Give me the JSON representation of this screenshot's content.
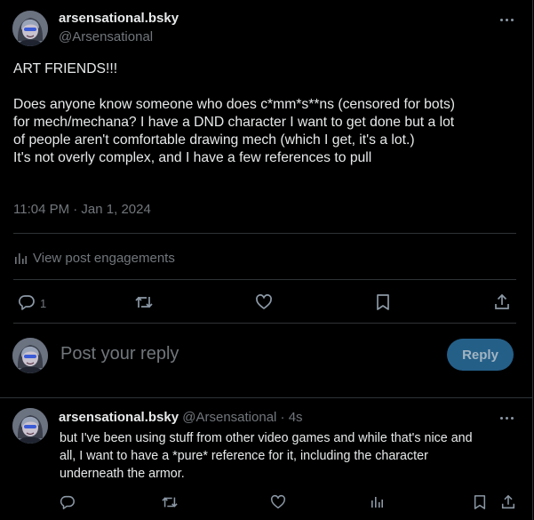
{
  "tweet": {
    "author": {
      "display_name": "arsensational.bsky",
      "handle": "@Arsensational",
      "avatar_icon": "avatar-icon"
    },
    "text_lines": [
      "ART FRIENDS!!!",
      "",
      "Does anyone know someone who does c*mm*s**ns (censored for bots)",
      "for mech/mechana? I have a DND character I want to get done but a lot",
      "of people aren't comfortable drawing mech (which I get, it's a lot.)",
      "It's not overly complex, and I have a few references to pull"
    ],
    "timestamp": "11:04 PM · Jan 1, 2024",
    "engagements_label": "View post engagements",
    "actions": {
      "reply_count": "1"
    }
  },
  "composer": {
    "placeholder": "Post your reply",
    "button_label": "Reply"
  },
  "reply": {
    "display_name": "arsensational.bsky",
    "meta": "@Arsensational · 4s",
    "text_lines": [
      "but I've been using stuff from other video games and while that's nice and",
      "all, I want to have a *pure* reference for it, including the character",
      "underneath the armor."
    ]
  },
  "colors": {
    "background": "#000000",
    "text_primary": "#e7e9ea",
    "text_secondary": "#71767b",
    "divider": "#2f3336",
    "reply_button_bg": "#245f88",
    "reply_button_text": "#a3b4c2"
  }
}
